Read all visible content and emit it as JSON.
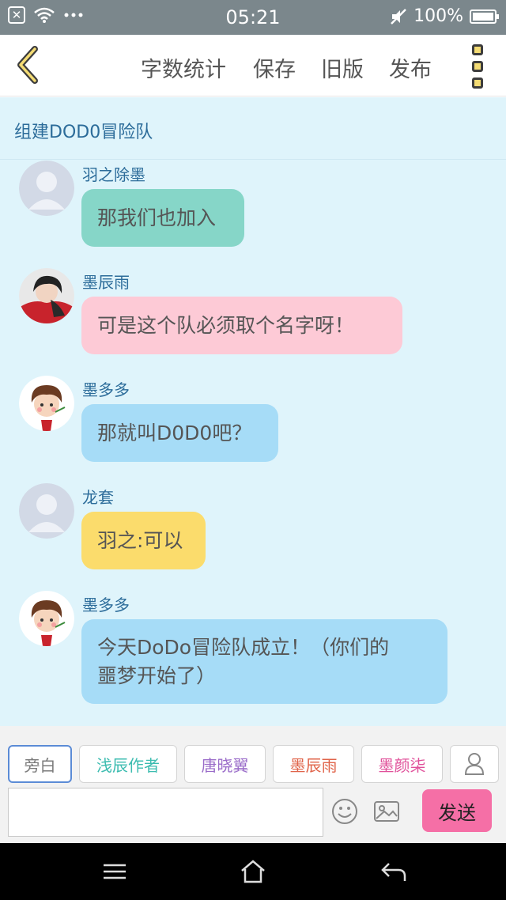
{
  "status_bar": {
    "time": "05:21",
    "battery": "100%"
  },
  "header": {
    "word_count": "字数统计",
    "save": "保存",
    "old_version": "旧版",
    "publish": "发布"
  },
  "chat": {
    "title": "组建DOD0冒险队",
    "messages": [
      {
        "sender": "羽之除墨",
        "text": "那我们也加入",
        "color": "#86d6c8"
      },
      {
        "sender": "墨辰雨",
        "text": "可是这个队必须取个名字呀！",
        "color": "#fdcad6"
      },
      {
        "sender": "墨多多",
        "text": "那就叫D0D0吧？",
        "color": "#a6dcf7"
      },
      {
        "sender": "龙套",
        "text": "羽之:可以",
        "color": "#fbdc6c"
      },
      {
        "sender": "墨多多",
        "text_line1": "今天DoDo冒险队成立！（你们的",
        "text_line2": "噩梦开始了）",
        "color": "#a6dcf7"
      }
    ]
  },
  "roles": [
    {
      "label": "旁白",
      "color": "#7a7a7a"
    },
    {
      "label": "浅辰作者",
      "color": "#3cbcb0"
    },
    {
      "label": "唐晓翼",
      "color": "#9a6cc9"
    },
    {
      "label": "墨辰雨",
      "color": "#e0644a"
    },
    {
      "label": "墨颜柒",
      "color": "#e0509a"
    }
  ],
  "composer": {
    "input_value": "",
    "send_label": "发送"
  },
  "icons": {
    "back": "chevron-left-icon",
    "more": "more-vertical-icon",
    "emoji": "smiley-icon",
    "image": "image-icon",
    "person": "person-icon"
  }
}
